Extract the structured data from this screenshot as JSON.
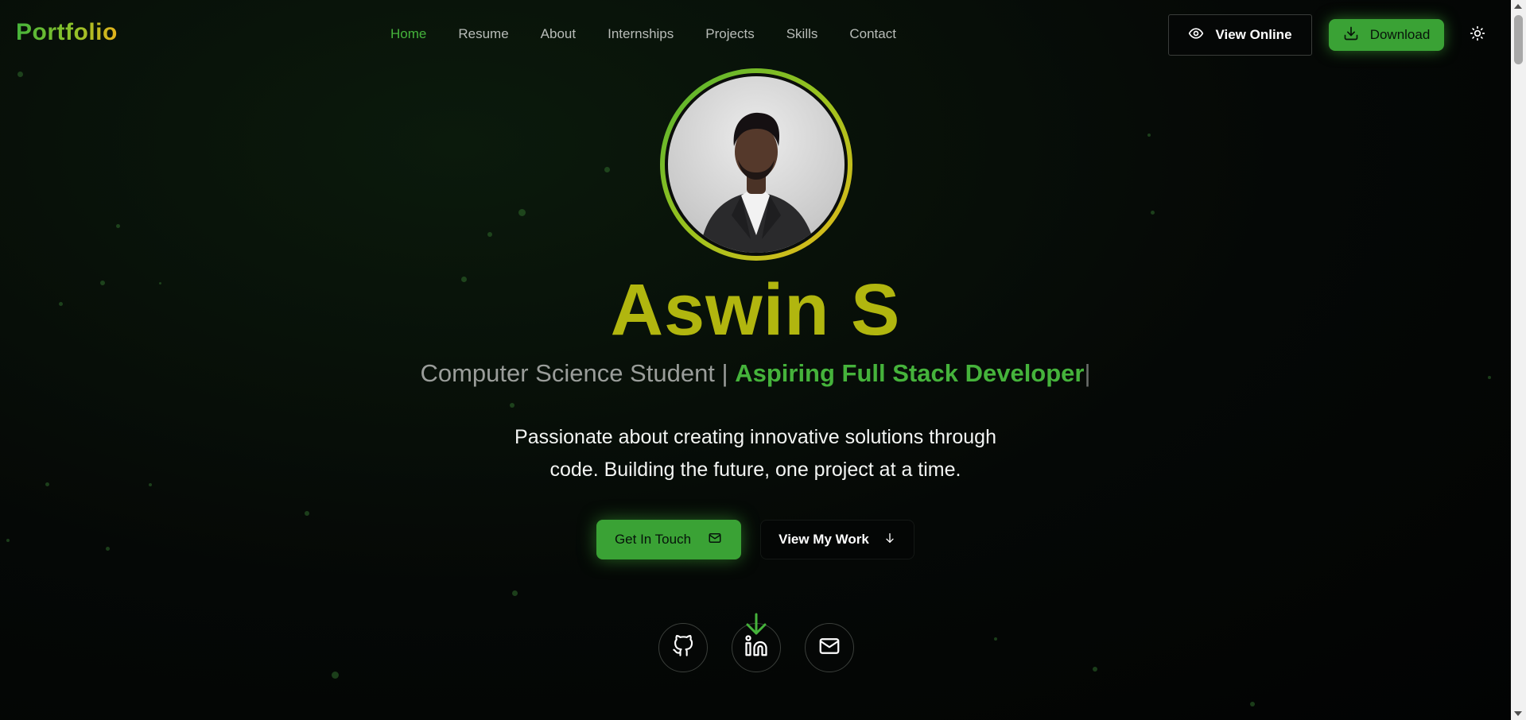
{
  "header": {
    "logo": "Portfolio",
    "nav": [
      {
        "label": "Home",
        "active": true
      },
      {
        "label": "Resume",
        "active": false
      },
      {
        "label": "About",
        "active": false
      },
      {
        "label": "Internships",
        "active": false
      },
      {
        "label": "Projects",
        "active": false
      },
      {
        "label": "Skills",
        "active": false
      },
      {
        "label": "Contact",
        "active": false
      }
    ],
    "view_online_label": "View Online",
    "download_label": "Download",
    "icons": {
      "view_online": "eye-icon",
      "download": "download-icon",
      "theme": "sun-icon"
    }
  },
  "hero": {
    "avatar": "profile-photo",
    "name": "Aswin S",
    "subtitle_prefix": "Computer Science Student | ",
    "subtitle_highlight": "Aspiring Full Stack Developer",
    "subtitle_cursor": "|",
    "description_lines": [
      "Passionate about creating innovative solutions through",
      "code. Building the future, one project at a time."
    ],
    "cta_primary": "Get In Touch",
    "cta_secondary": "View My Work",
    "icons": {
      "cta_primary": "mail-icon",
      "cta_secondary": "arrow-down-icon"
    }
  },
  "social": [
    {
      "icon": "github-icon"
    },
    {
      "icon": "linkedin-icon"
    },
    {
      "icon": "mail-icon"
    }
  ],
  "colors": {
    "accent": "#45b33b",
    "name": "#b1b60f",
    "gold": "#e7b91a",
    "background": "#050806"
  }
}
